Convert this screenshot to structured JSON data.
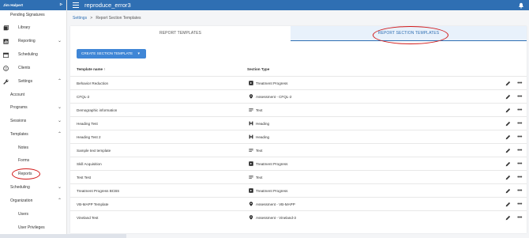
{
  "app": {
    "user_name": "Jim Halpert",
    "title": "reproduce_error3"
  },
  "sidebar": {
    "items": [
      {
        "label": "Pending Signatures"
      },
      {
        "label": "Library"
      },
      {
        "label": "Reporting"
      },
      {
        "label": "Scheduling"
      },
      {
        "label": "Clients"
      },
      {
        "label": "Settings"
      },
      {
        "label": "Account"
      },
      {
        "label": "Programs"
      },
      {
        "label": "Sessions"
      },
      {
        "label": "Templates"
      },
      {
        "label": "Notes"
      },
      {
        "label": "Forms"
      },
      {
        "label": "Reports"
      },
      {
        "label": "Scheduling"
      },
      {
        "label": "Organization"
      },
      {
        "label": "Users"
      },
      {
        "label": "User Privileges"
      }
    ]
  },
  "breadcrumb": {
    "root": "Settings",
    "separator": ">",
    "current": "Report Section Templates"
  },
  "tabs": [
    {
      "label": "REPORT TEMPLATES"
    },
    {
      "label": "REPORT SECTION TEMPLATES"
    }
  ],
  "create_button": {
    "label": "CREATE SECTION TEMPLATE"
  },
  "table": {
    "columns": [
      "Template name ↑",
      "Section Type"
    ],
    "rows": [
      {
        "name": "Behavior Reduction",
        "type": "Treatment Progress",
        "type_icon": "treatment-icon"
      },
      {
        "name": "CFQL-2",
        "type": "Assessment - CFQL-2",
        "type_icon": "location-icon"
      },
      {
        "name": "Demographic information",
        "type": "Text",
        "type_icon": "text-icon"
      },
      {
        "name": "Heading Test",
        "type": "Heading",
        "type_icon": "heading-icon"
      },
      {
        "name": "Heading Test 2",
        "type": "Heading",
        "type_icon": "heading-icon"
      },
      {
        "name": "Sample text template",
        "type": "Text",
        "type_icon": "text-icon"
      },
      {
        "name": "Skill Acquisition",
        "type": "Treatment Progress",
        "type_icon": "treatment-icon"
      },
      {
        "name": "Test Test",
        "type": "Text",
        "type_icon": "text-icon"
      },
      {
        "name": "Treatment Progress BCBS",
        "type": "Treatment Progress",
        "type_icon": "treatment-icon"
      },
      {
        "name": "VB-MAPP Template",
        "type": "Assessment - VB-MAPP",
        "type_icon": "location-icon"
      },
      {
        "name": "Vineland Test",
        "type": "Assessment - Vineland-3",
        "type_icon": "location-icon"
      }
    ]
  },
  "colors": {
    "primary": "#2f6fb3",
    "button": "#3f86d6",
    "active_tab_bg": "#e8f1fb",
    "annotation_ring": "#d21919"
  }
}
